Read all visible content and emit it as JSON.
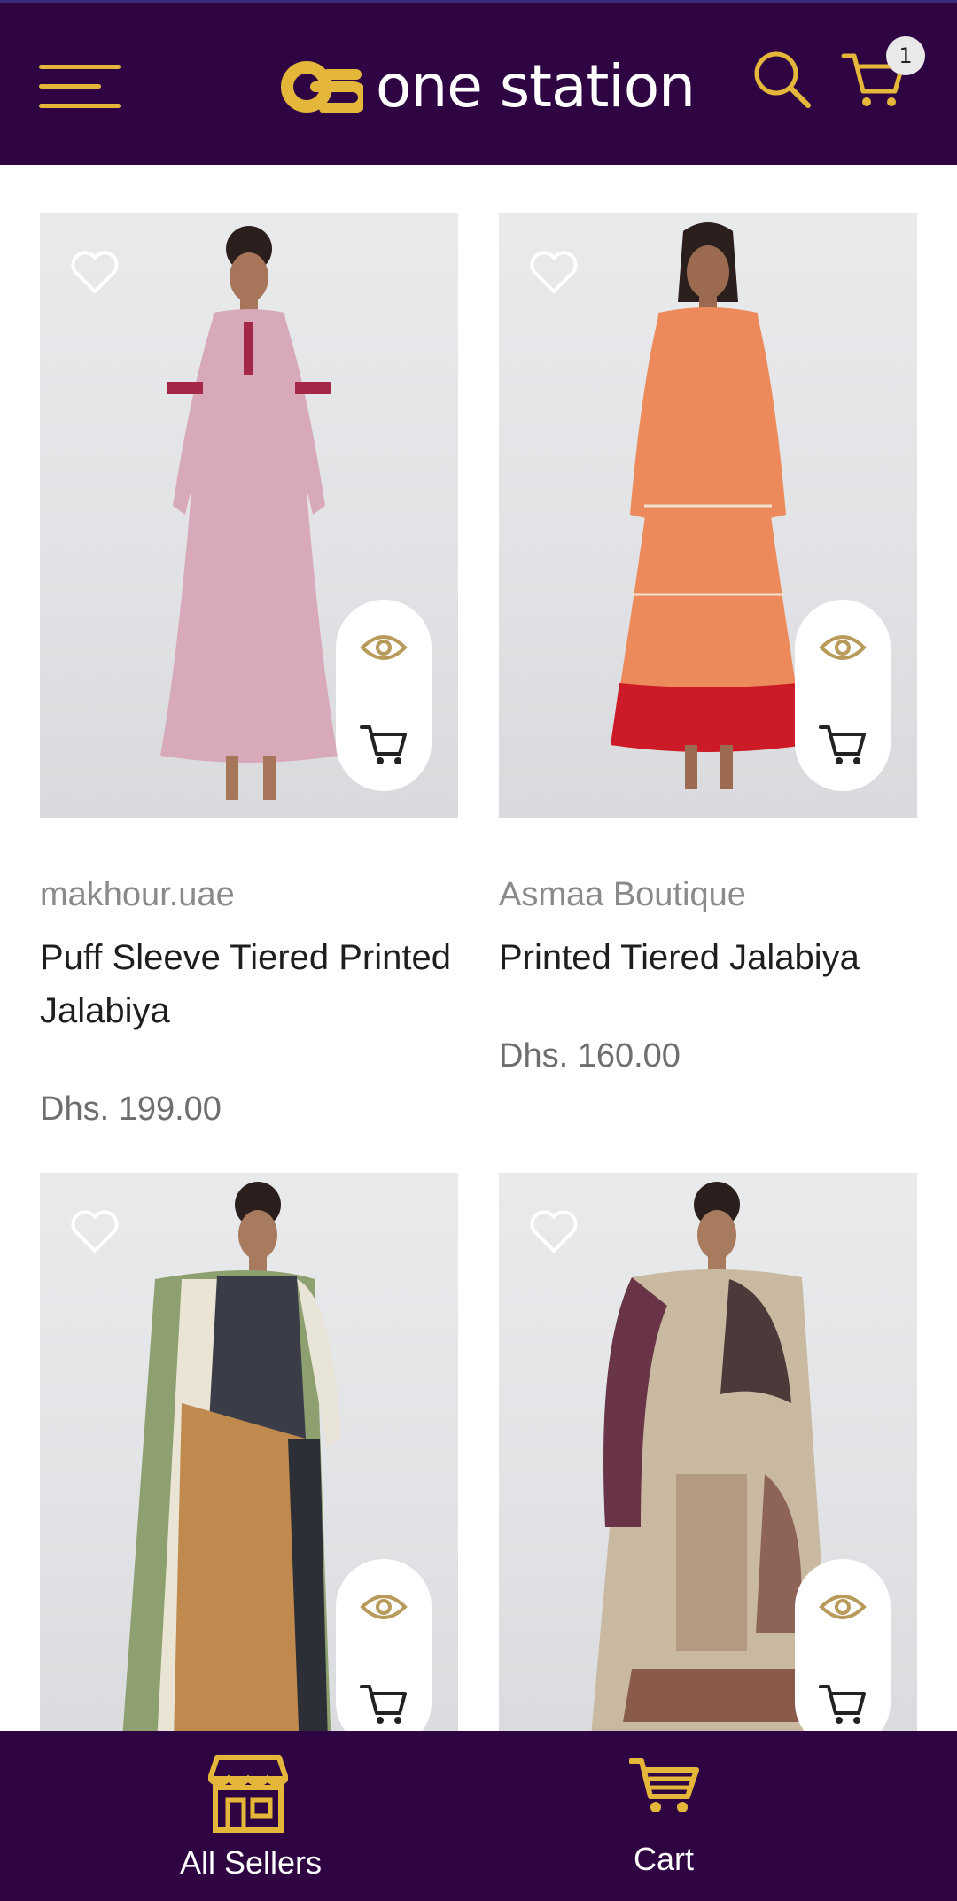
{
  "header": {
    "brand_name": "one station",
    "cart_count": "1",
    "accent_color": "#e4b73a",
    "background_color": "#2f0442"
  },
  "products": [
    {
      "seller": "makhour.uae",
      "title": "Puff Sleeve Tiered Printed Jalabiya",
      "price": "Dhs. 199.00",
      "dress_color": "#d8a9b8"
    },
    {
      "seller": "Asmaa Boutique",
      "title": "Printed Tiered Jalabiya",
      "price": "Dhs. 160.00",
      "dress_color": "#ec8a5c"
    },
    {
      "dress_color": "#c08a4e"
    },
    {
      "dress_color": "#c8b9a0"
    }
  ],
  "bottom_nav": {
    "sellers_label": "All Sellers",
    "cart_label": "Cart"
  },
  "icons": [
    "menu-icon",
    "search-icon",
    "cart-icon",
    "heart-icon",
    "eye-icon",
    "store-icon"
  ]
}
